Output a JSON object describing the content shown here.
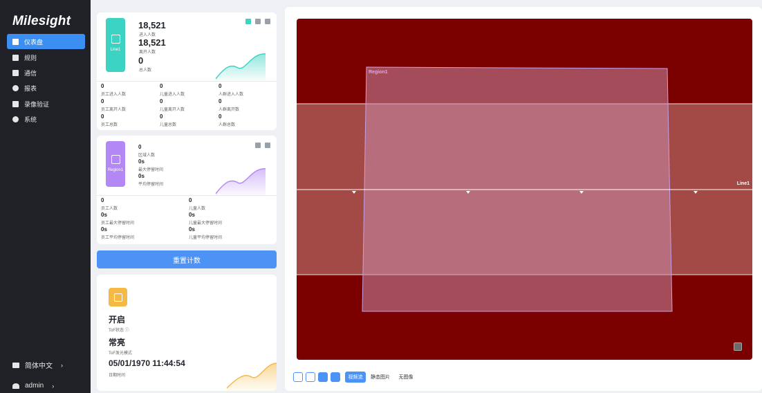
{
  "app": {
    "brand": "Milesight"
  },
  "sidebar": {
    "items": [
      {
        "label": "仪表盘",
        "icon": "dashboard-icon",
        "active": true
      },
      {
        "label": "规则",
        "icon": "rules-icon",
        "active": false
      },
      {
        "label": "通信",
        "icon": "communication-icon",
        "active": false
      },
      {
        "label": "报表",
        "icon": "report-icon",
        "active": false
      },
      {
        "label": "录像验证",
        "icon": "video-verify-icon",
        "active": false
      },
      {
        "label": "系统",
        "icon": "gear-icon",
        "active": false
      }
    ],
    "language": {
      "label": "简体中文",
      "icon": "language-icon"
    },
    "user": {
      "label": "admin",
      "icon": "user-icon"
    }
  },
  "line_card": {
    "badge_label": "Line1",
    "in_count": "18,521",
    "in_label": "进入人数",
    "out_count": "18,521",
    "out_label": "离开人数",
    "total_count": "0",
    "total_label": "总人数",
    "accent": "#3cd3c2",
    "stats": [
      {
        "value": "0",
        "label": "员工进入人数"
      },
      {
        "value": "0",
        "label": "儿童进入人数"
      },
      {
        "value": "0",
        "label": "人群进入人数"
      },
      {
        "value": "0",
        "label": "员工离开人数"
      },
      {
        "value": "0",
        "label": "儿童离开人数"
      },
      {
        "value": "0",
        "label": "人群离开数"
      },
      {
        "value": "0",
        "label": "员工总数"
      },
      {
        "value": "0",
        "label": "儿童总数"
      },
      {
        "value": "0",
        "label": "人群总数"
      }
    ]
  },
  "region_card": {
    "badge_label": "Region1",
    "count": "0",
    "count_label": "区域人数",
    "max_dwell": "0s",
    "max_dwell_label": "最大停留时间",
    "avg_dwell": "0s",
    "avg_dwell_label": "平均停留时间",
    "accent": "#b388f5",
    "stats": [
      {
        "value": "0",
        "label": "员工人数"
      },
      {
        "value": "0",
        "label": "儿童人数"
      },
      {
        "value": "0s",
        "label": "员工最大停留时间"
      },
      {
        "value": "0s",
        "label": "儿童最大停留时间"
      },
      {
        "value": "0s",
        "label": "员工平均停留时间"
      },
      {
        "value": "0s",
        "label": "儿童平均停留时间"
      }
    ]
  },
  "reset_button": {
    "label": "重置计数"
  },
  "tof_card": {
    "status_value": "开启",
    "status_label": "ToF状态 ⓘ",
    "light_value": "常亮",
    "light_label": "ToF发光模式",
    "datetime_value": "05/01/1970 11:44:54",
    "datetime_label": "日期时间",
    "accent": "#f5b945"
  },
  "video": {
    "region_label": "Region1",
    "line_label": "Line1",
    "modes": [
      "视频流",
      "静态图片",
      "无图像"
    ],
    "active_mode": "视频流",
    "colors": {
      "background": "#7b0000",
      "band": "#a34a47",
      "region_fill": "#c88aa6",
      "region_stroke": "#c69fe6"
    }
  }
}
